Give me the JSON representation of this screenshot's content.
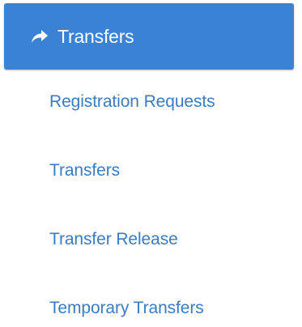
{
  "menu": {
    "header": {
      "label": "Transfers",
      "icon": "share-arrow-icon"
    },
    "items": [
      {
        "label": "Registration Requests"
      },
      {
        "label": "Transfers"
      },
      {
        "label": "Transfer Release"
      },
      {
        "label": "Temporary Transfers"
      }
    ]
  },
  "colors": {
    "header_background": "#3b82d4",
    "header_text": "#ffffff",
    "link_text": "#3a7bc3",
    "page_background": "#ffffff"
  }
}
